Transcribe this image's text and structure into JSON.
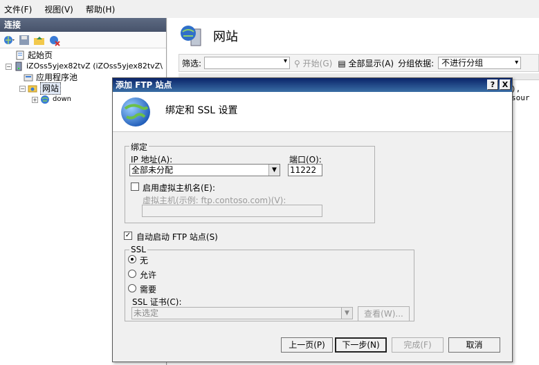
{
  "menu": {
    "file": "文件(F)",
    "view": "视图(V)",
    "help": "帮助(H)"
  },
  "left": {
    "header": "连接",
    "tree": {
      "start_page": "起始页",
      "server": "iZOss5yjex82tvZ (iZOss5yjex82tvZ\\",
      "app_pools": "应用程序池",
      "sites": "网站",
      "site_down": "down"
    }
  },
  "right": {
    "title": "网站",
    "filter_label": "筛选:",
    "start_btn": "开始(G)",
    "show_all_btn": "全部显示(A)",
    "group_by_label": "分组依据:",
    "group_by_value": "不进行分组",
    "snippet": "), sour"
  },
  "dialog": {
    "title": "添加 FTP 站点",
    "help_btn": "?",
    "close_btn": "X",
    "heading": "绑定和 SSL 设置",
    "binding": {
      "legend": "绑定",
      "ip_label": "IP 地址(A):",
      "ip_value": "全部未分配",
      "port_label": "端口(O):",
      "port_value": "11222",
      "vhost_label": "启用虚拟主机名(E):",
      "vhost_field_label": "虚拟主机(示例: ftp.contoso.com)(V):",
      "vhost_value": ""
    },
    "auto_start_label": "自动启动 FTP 站点(S)",
    "ssl": {
      "legend": "SSL",
      "none": "无",
      "allow": "允许",
      "require": "需要",
      "cert_label": "SSL 证书(C):",
      "cert_value": "未选定",
      "view_btn": "查看(W)..."
    },
    "buttons": {
      "prev": "上一页(P)",
      "next": "下一步(N)",
      "finish": "完成(F)",
      "cancel": "取消"
    }
  },
  "colors": {
    "title_bar": "#0a246a",
    "left_header": "#5d6a82"
  }
}
